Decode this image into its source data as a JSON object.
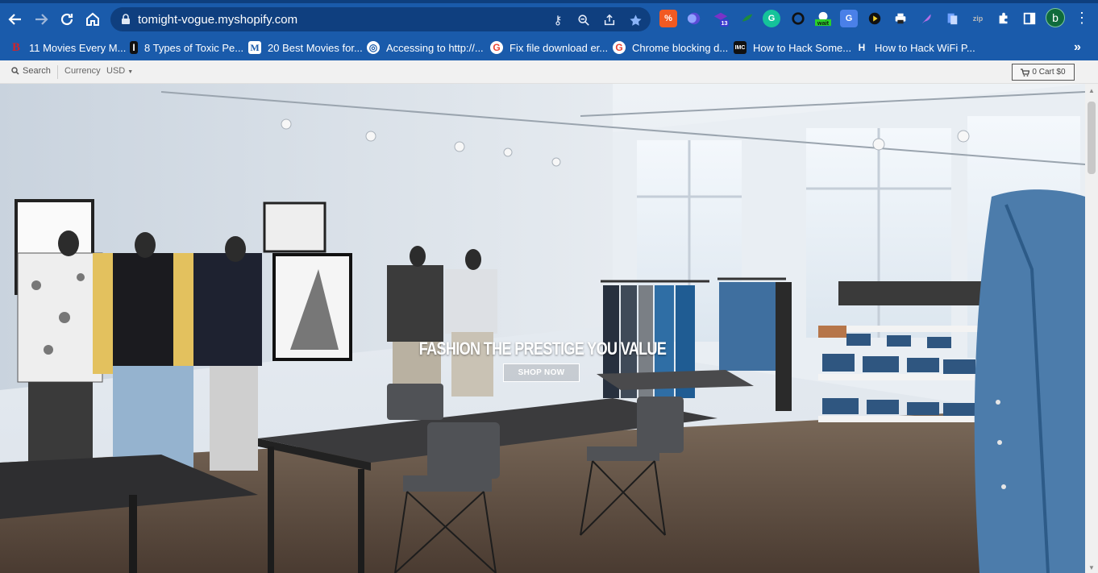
{
  "browser": {
    "url": "tomight-vogue.myshopify.com",
    "profile_initial": "b",
    "extensions": [
      {
        "name": "honey-extension-icon",
        "label": "%",
        "color": "#f15a22"
      },
      {
        "name": "orb-extension-icon",
        "label": "",
        "color": "#5b4bd6"
      },
      {
        "name": "graduation-extension-icon",
        "label": "13",
        "color": "#6a2fb4"
      },
      {
        "name": "green-extension-icon",
        "label": "",
        "color": "#1d8a3b"
      },
      {
        "name": "grammarly-extension-icon",
        "label": "G",
        "color": "#15c39a"
      },
      {
        "name": "circle-extension-icon",
        "label": "",
        "color": "#222"
      },
      {
        "name": "wait-extension-icon",
        "label": "wait",
        "color": "#2ab22a"
      },
      {
        "name": "translate-extension-icon",
        "label": "",
        "color": "#4a80e8"
      },
      {
        "name": "play-extension-icon",
        "label": "",
        "color": "#1b1b1b"
      },
      {
        "name": "print-extension-icon",
        "label": "",
        "color": "#333"
      },
      {
        "name": "feather-extension-icon",
        "label": "",
        "color": "#9b59d0"
      },
      {
        "name": "doc-extension-icon",
        "label": "",
        "color": "#4a80e8"
      },
      {
        "name": "zip-extension-icon",
        "label": "zip",
        "color": "#888"
      }
    ],
    "bookmarks": [
      {
        "name": "bookmark-11-movies",
        "label": "11 Movies Every M...",
        "fav": "B",
        "fav_color": "#d0242b"
      },
      {
        "name": "bookmark-toxic",
        "label": "8 Types of Toxic Pe...",
        "fav": "I",
        "fav_color": "#111"
      },
      {
        "name": "bookmark-20-movies",
        "label": "20 Best Movies for...",
        "fav": "M",
        "fav_color": "#fff"
      },
      {
        "name": "bookmark-accessing",
        "label": "Accessing to http://...",
        "fav": "◎",
        "fav_color": "#fff"
      },
      {
        "name": "bookmark-fix-download",
        "label": "Fix file download er...",
        "fav": "G",
        "fav_color": "#fff"
      },
      {
        "name": "bookmark-chrome-blocking",
        "label": "Chrome blocking d...",
        "fav": "G",
        "fav_color": "#fff"
      },
      {
        "name": "bookmark-hack-some",
        "label": "How to Hack Some...",
        "fav": "IMC",
        "fav_color": "#111"
      },
      {
        "name": "bookmark-hack-wifi",
        "label": "How to Hack WiFi P...",
        "fav": "H",
        "fav_color": "#fff"
      }
    ]
  },
  "site": {
    "search_label": "Search",
    "currency_label": "Currency",
    "currency_value": "USD",
    "cart_label": "0 Cart $0",
    "hero_title": "FASHION THE PRESTIGE YOU VALUE",
    "hero_button": "SHOP NOW"
  }
}
